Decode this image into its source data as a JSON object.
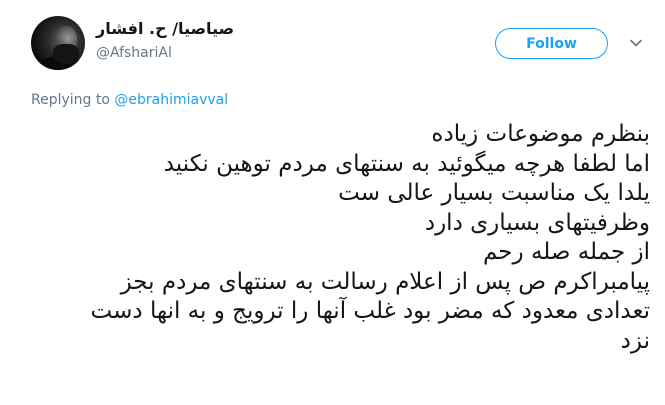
{
  "author": {
    "display_name": "صیاصیا/ ح. افشار",
    "handle": "@AfshariAl"
  },
  "follow_button": {
    "label": "Follow"
  },
  "icons": {
    "menu": "chevron-down-icon",
    "avatar": "profile-photo"
  },
  "reply": {
    "prefix": "Replying to ",
    "mention": "@ebrahimiavval"
  },
  "tweet_lines": [
    "بنظرم موضوعات زیاده",
    "اما لطفا هرچه میگوئید به سنتهای مردم توهین نکنید",
    "یلدا یک مناسبت بسیار عالی ست",
    "وظرفیتهای بسیاری دارد",
    "از جمله صله رحم",
    "پیامبراکرم ص پس از اعلام رسالت به سنتهای مردم بجز",
    "تعدادی معدود که مضر بود غلب آنها را ترویج و به انها دست",
    "نزد"
  ],
  "colors": {
    "accent": "#1da1f2",
    "text": "#14171a",
    "muted": "#657786"
  }
}
